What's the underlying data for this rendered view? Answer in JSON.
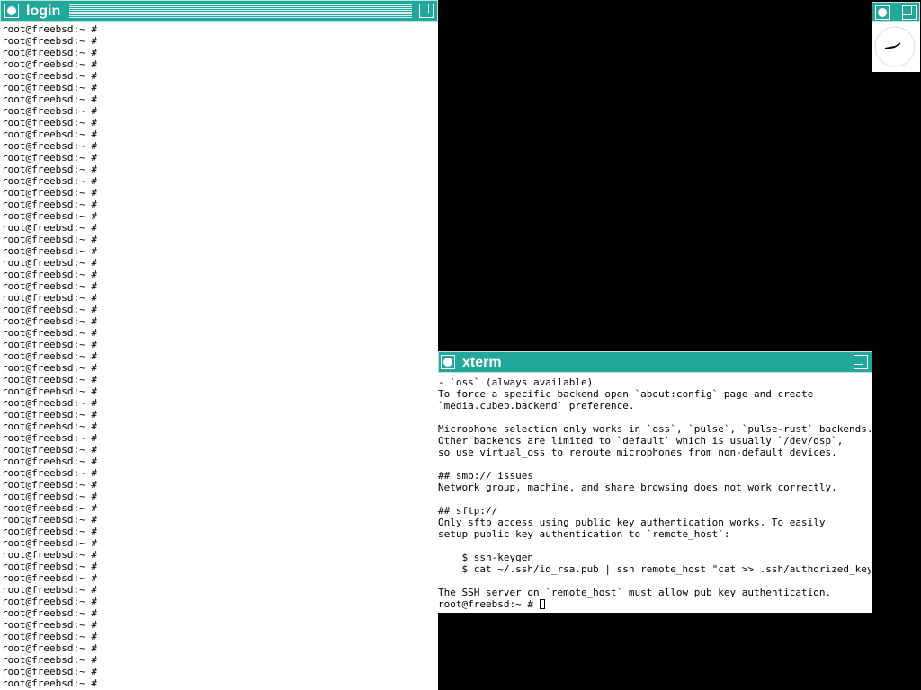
{
  "login_window": {
    "title": "login",
    "prompt": "root@freebsd:~ #",
    "line_count": 57
  },
  "xterm_window": {
    "title": "xterm",
    "lines": [
      "- `oss` (always available)",
      "To force a specific backend open `about:config` page and create",
      "`media.cubeb.backend` preference.",
      "",
      "Microphone selection only works in `oss`, `pulse`, `pulse-rust` backends.",
      "Other backends are limited to `default` which is usually `/dev/dsp`,",
      "so use virtual_oss to reroute microphones from non-default devices.",
      "",
      "## smb:// issues",
      "Network group, machine, and share browsing does not work correctly.",
      "",
      "## sftp://",
      "Only sftp access using public key authentication works. To easily",
      "setup public key authentication to `remote_host`:",
      "",
      "    $ ssh-keygen",
      "    $ cat ~/.ssh/id_rsa.pub | ssh remote_host \"cat >> .ssh/authorized_keys\"",
      "",
      "The SSH server on `remote_host` must allow pub key authentication."
    ],
    "prompt": "root@freebsd:~ #"
  },
  "clock_window": {
    "icons": [
      "iconify-icon",
      "resize-icon"
    ]
  },
  "colors": {
    "titlebar": "#22a89b",
    "background": "#000000"
  }
}
